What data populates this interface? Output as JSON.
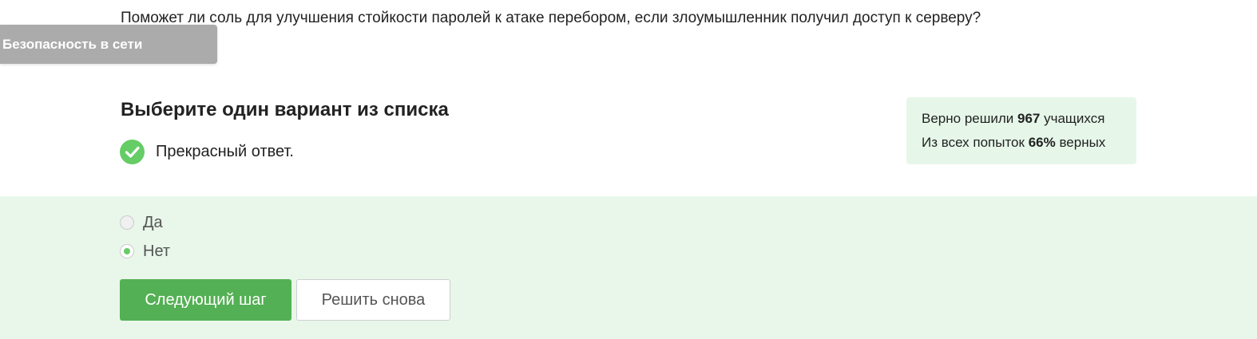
{
  "question": {
    "text": "Поможет ли соль для улучшения стойкости паролей к атаке перебором, если злоумышленник получил доступ к серверу?"
  },
  "topic_tag": {
    "label": "Безопасность в сети"
  },
  "task": {
    "heading": "Выберите один вариант из списка",
    "feedback_icon": "check-circle-icon",
    "feedback_text": "Прекрасный ответ."
  },
  "stats": {
    "solved_prefix": "Верно решили",
    "solved_count": "967",
    "solved_suffix": "учащихся",
    "attempts_prefix": "Из всех попыток",
    "attempts_percent": "66%",
    "attempts_suffix": "верных"
  },
  "options": [
    {
      "label": "Да",
      "selected": false
    },
    {
      "label": "Нет",
      "selected": true
    }
  ],
  "buttons": {
    "next_label": "Следующий шаг",
    "retry_label": "Решить снова"
  },
  "colors": {
    "accent_green": "#54b054",
    "check_green": "#66cc66",
    "answer_bg": "#e8f7ea",
    "stats_bg": "#e6f7e9",
    "tag_gray": "#ababab"
  }
}
